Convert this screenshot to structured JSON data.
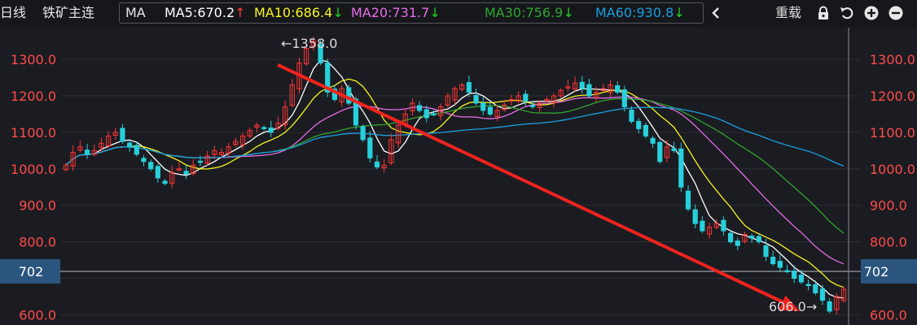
{
  "header": {
    "tab": "日线",
    "symbol": "铁矿主连",
    "reload": "重载"
  },
  "colors": {
    "up": "#ff3535",
    "down": "#27d0dc",
    "ma5": "#ffffff",
    "ma10": "#f5f51e",
    "ma20": "#e56be5",
    "ma30": "#2fa52f",
    "ma60": "#1c9ee0",
    "trend_arrow": "#f0231e",
    "bg": "#1b1c21"
  },
  "icons": [
    "chevron-left-icon",
    "lock-icon",
    "undo-icon",
    "zoom-in-icon",
    "zoom-out-icon"
  ],
  "chart_data": {
    "type": "candlestick",
    "indicator_name": "MA",
    "ma_legend": [
      {
        "label": "MA5:670.2",
        "arrow": "↑",
        "direction": "up",
        "color": "#ffffff"
      },
      {
        "label": "MA10:686.4",
        "arrow": "↓",
        "direction": "down",
        "color": "#f5f51e"
      },
      {
        "label": "MA20:731.7",
        "arrow": "↓",
        "direction": "down",
        "color": "#e56be5"
      },
      {
        "label": "MA30:756.9",
        "arrow": "↓",
        "direction": "down",
        "color": "#2fa52f"
      },
      {
        "label": "MA60:930.8",
        "arrow": "↓",
        "direction": "down",
        "color": "#1c9ee0"
      }
    ],
    "y_ticks": [
      "1300.0",
      "1200.0",
      "1100.0",
      "1000.0",
      "900.0",
      "800.0",
      "700.0",
      "600.0"
    ],
    "ylim": [
      572,
      1387
    ],
    "current_price": "702",
    "annotations": {
      "high": "1358.0",
      "low": "606.0"
    },
    "trend_line": {
      "from": 1285,
      "to": 610
    },
    "candles_close_approx": [
      1010,
      1045,
      1060,
      1040,
      1050,
      1070,
      1090,
      1100,
      1075,
      1060,
      1040,
      1020,
      1000,
      975,
      960,
      990,
      1000,
      985,
      1010,
      1020,
      1035,
      1050,
      1045,
      1060,
      1075,
      1090,
      1105,
      1120,
      1110,
      1100,
      1125,
      1170,
      1230,
      1290,
      1330,
      1350,
      1290,
      1210,
      1190,
      1220,
      1180,
      1120,
      1080,
      1030,
      1005,
      1010,
      1080,
      1120,
      1150,
      1180,
      1160,
      1140,
      1150,
      1170,
      1200,
      1220,
      1230,
      1210,
      1180,
      1160,
      1150,
      1160,
      1175,
      1190,
      1200,
      1185,
      1170,
      1180,
      1190,
      1200,
      1215,
      1225,
      1235,
      1220,
      1200,
      1210,
      1220,
      1230,
      1210,
      1170,
      1130,
      1110,
      1090,
      1070,
      1020,
      1060,
      1050,
      950,
      890,
      850,
      830,
      840,
      850,
      830,
      800,
      790,
      820,
      810,
      800,
      760,
      740,
      730,
      720,
      700,
      690,
      680,
      660,
      640,
      610,
      650,
      670
    ]
  }
}
